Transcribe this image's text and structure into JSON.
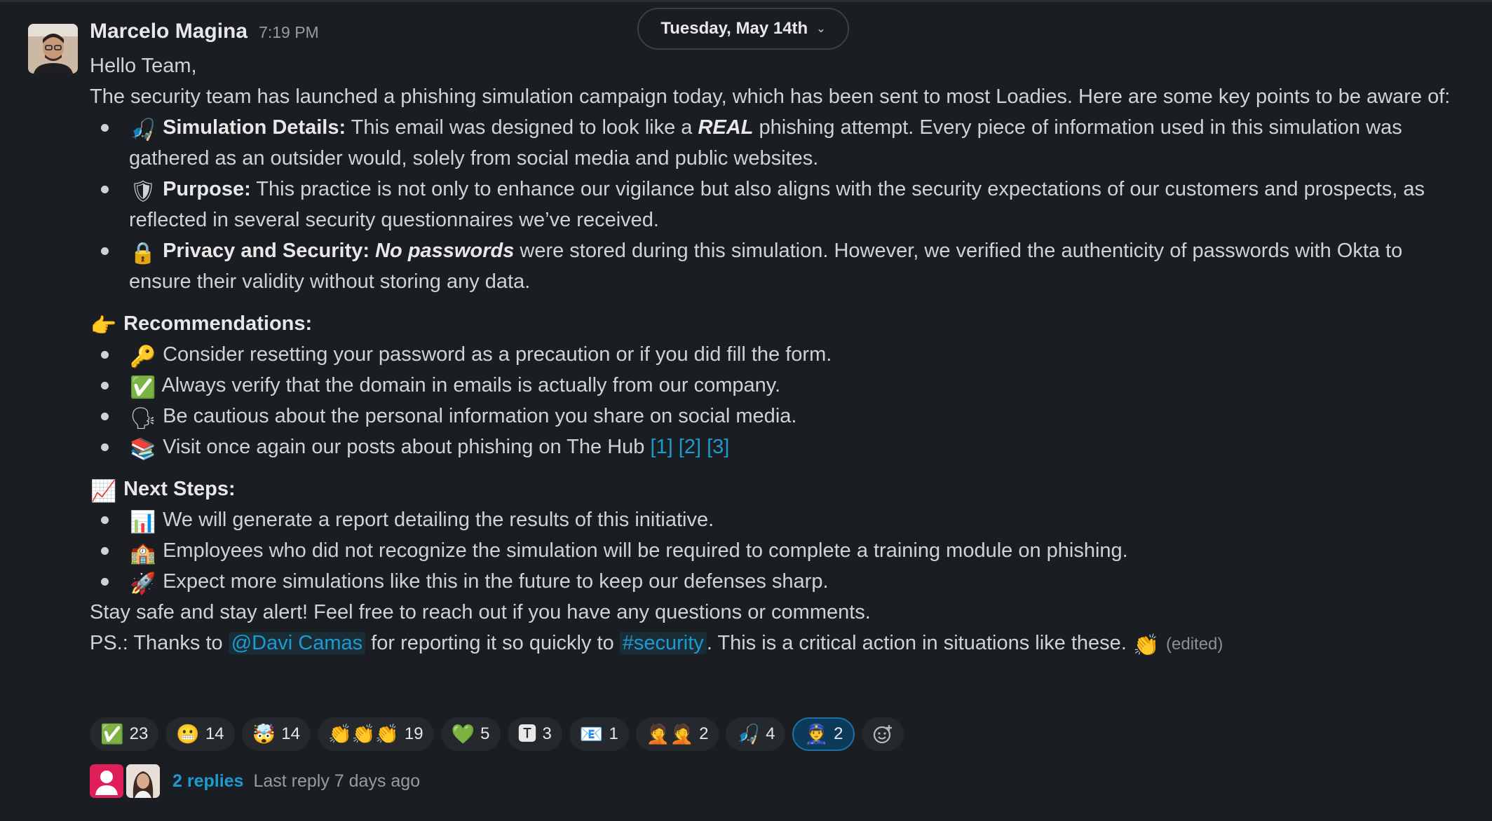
{
  "date_divider": {
    "label": "Tuesday, May 14th"
  },
  "message": {
    "author": "Marcelo Magina",
    "time": "7:19 PM",
    "greeting": "Hello Team,",
    "intro": "The security team has launched a phishing simulation campaign today, which has been sent to most Loadies. Here are some key points to be aware of:",
    "points": [
      {
        "icon": "fishing-pole-icon",
        "glyph": "🎣",
        "title": "Simulation Details:",
        "pre": " This email was designed to look like a ",
        "emph": "REAL",
        "post": " phishing attempt. Every piece of information used in this simulation was gathered as an outsider would, solely from social media and public websites."
      },
      {
        "icon": "shield-icon",
        "glyph": "🛡",
        "title": "Purpose:",
        "text": " This practice is not only to enhance our vigilance but also aligns with the security expectations of our customers and prospects, as reflected in several security questionnaires we’ve received."
      },
      {
        "icon": "lock-icon",
        "glyph": "🔒",
        "title": "Privacy and Security:",
        "emph": "No passwords",
        "post": " were stored during this simulation. However, we verified the authenticity of passwords with Okta to ensure their validity without storing any data."
      }
    ],
    "recommendations": {
      "icon": "pointing-hand-icon",
      "glyph": "👉",
      "heading": "Recommendations:",
      "items": [
        {
          "icon": "key-icon",
          "glyph": "🔑",
          "text": "Consider resetting your password as a precaution or if you did fill the form."
        },
        {
          "icon": "check-mark-icon",
          "glyph": "✅",
          "text": "Always verify that the domain in emails is actually from our company."
        },
        {
          "icon": "speaking-head-icon",
          "glyph": "🗣",
          "text": "Be cautious about the personal information you share on social media."
        },
        {
          "icon": "books-icon",
          "glyph": "📚",
          "text": "Visit once again our posts about phishing on The Hub ",
          "links": [
            "[1]",
            "[2]",
            "[3]"
          ]
        }
      ]
    },
    "next_steps": {
      "icon": "chart-increasing-icon",
      "glyph": "📈",
      "heading": "Next Steps:",
      "items": [
        {
          "icon": "bar-chart-icon",
          "glyph": "📊",
          "text": "We will generate a report detailing the results of this initiative."
        },
        {
          "icon": "school-icon",
          "glyph": "🏫",
          "text": "Employees who did not recognize the simulation will be required to complete a training module on phishing."
        },
        {
          "icon": "rocket-icon",
          "glyph": "🚀",
          "text": "Expect more simulations like this in the future to keep our defenses sharp."
        }
      ]
    },
    "closing": "Stay safe and stay alert! Feel free to reach out if you have any questions or comments.",
    "ps": {
      "pre": "PS.: Thanks to ",
      "mention": "@Davi Camas",
      "mid": " for reporting it so quickly to ",
      "channel": "#security",
      "post": ". This is a critical action in situations like these. ",
      "glyph": "👏",
      "edited": "(edited)"
    }
  },
  "reactions": [
    {
      "icon": "check-mark-icon",
      "glyph": "✅",
      "count": "23"
    },
    {
      "icon": "grimacing-face-icon",
      "glyph": "😬",
      "count": "14"
    },
    {
      "icon": "exploding-head-icon",
      "glyph": "🤯",
      "count": "14"
    },
    {
      "icon": "clapping-hands-icon",
      "glyph": "👏👏👏",
      "count": "19"
    },
    {
      "icon": "green-heart-icon",
      "glyph": "💚",
      "count": "5"
    },
    {
      "icon": "ty-icon",
      "glyph": "🆃",
      "count": "3"
    },
    {
      "icon": "envelope-icon",
      "glyph": "📧",
      "count": "1"
    },
    {
      "icon": "facepalm-icon",
      "glyph": "🤦🤦",
      "count": "2"
    },
    {
      "icon": "fishing-pole-icon",
      "glyph": "🎣",
      "count": "4"
    },
    {
      "icon": "police-officer-icon",
      "glyph": "👮",
      "count": "2",
      "active": true
    }
  ],
  "thread": {
    "replies": "2 replies",
    "last_reply": "Last reply 7 days ago"
  }
}
